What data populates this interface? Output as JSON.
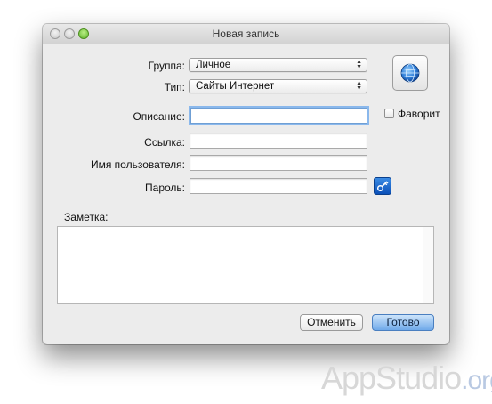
{
  "window": {
    "title": "Новая запись"
  },
  "form": {
    "group_label": "Группа:",
    "group_value": "Личное",
    "type_label": "Тип:",
    "type_value": "Сайты Интернет",
    "description_label": "Описание:",
    "description_value": "",
    "link_label": "Ссылка:",
    "link_value": "",
    "username_label": "Имя пользователя:",
    "username_value": "",
    "password_label": "Пароль:",
    "password_value": "",
    "favorite_label": "Фаворит",
    "favorite_checked": false,
    "note_label": "Заметка:",
    "note_value": ""
  },
  "buttons": {
    "cancel": "Отменить",
    "done": "Готово"
  },
  "icons": {
    "entry_icon": "globe-icon",
    "password_generator": "key-icon",
    "popup_arrows": "up-down-arrows-icon"
  },
  "watermark": {
    "main": "AppStudio",
    "suffix": ".org"
  },
  "colors": {
    "window_bg": "#ececec",
    "default_button": "#6fa9ea",
    "focus_ring": "#8ab8ec",
    "zoom_button": "#5fb52c"
  }
}
